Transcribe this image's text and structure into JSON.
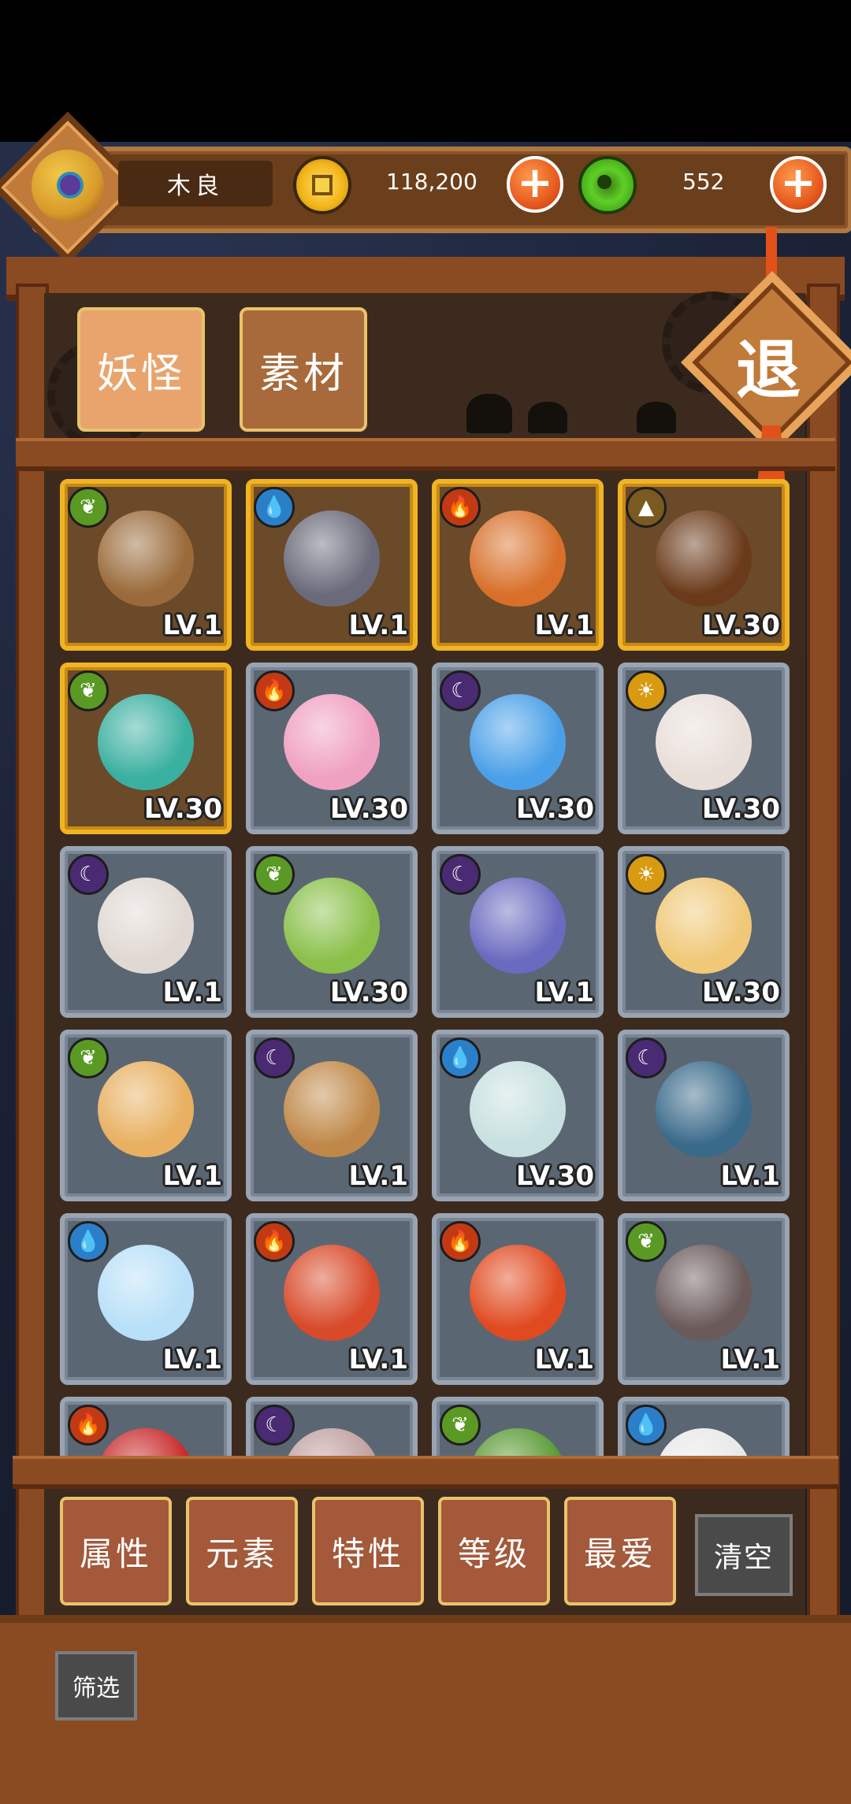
{
  "player": {
    "name": "木良"
  },
  "currency": {
    "coins": "118,200",
    "jade": "552",
    "plus": "+"
  },
  "tabs": [
    {
      "label": "妖怪",
      "active": true
    },
    {
      "label": "素材",
      "active": false
    }
  ],
  "exit_label": "退",
  "elements": {
    "wood": {
      "color": "#5a9a24",
      "glyph": "❦"
    },
    "water": {
      "color": "#2a7fc8",
      "glyph": "💧"
    },
    "fire": {
      "color": "#c23a14",
      "glyph": "🔥"
    },
    "earth": {
      "color": "#7a5a20",
      "glyph": "▲"
    },
    "dark": {
      "color": "#4a2a72",
      "glyph": "☾"
    },
    "light": {
      "color": "#d89a10",
      "glyph": "☀"
    }
  },
  "cards": [
    {
      "element": "wood",
      "level": "LV.1",
      "frame": "gold",
      "art": "#9a6a3a"
    },
    {
      "element": "water",
      "level": "LV.1",
      "frame": "gold",
      "art": "#6a6a7a"
    },
    {
      "element": "fire",
      "level": "LV.1",
      "frame": "gold",
      "art": "#d8702a"
    },
    {
      "element": "earth",
      "level": "LV.30",
      "frame": "gold",
      "art": "#6a3a1a"
    },
    {
      "element": "wood",
      "level": "LV.30",
      "frame": "gold",
      "art": "#3ab0a0"
    },
    {
      "element": "fire",
      "level": "LV.30",
      "frame": "silver",
      "art": "#f0a0c0"
    },
    {
      "element": "dark",
      "level": "LV.30",
      "frame": "silver",
      "art": "#4aa0e8"
    },
    {
      "element": "light",
      "level": "LV.30",
      "frame": "silver",
      "art": "#e8ded8"
    },
    {
      "element": "dark",
      "level": "LV.1",
      "frame": "silver",
      "art": "#e0d8d2"
    },
    {
      "element": "wood",
      "level": "LV.30",
      "frame": "silver",
      "art": "#8ac04a"
    },
    {
      "element": "dark",
      "level": "LV.1",
      "frame": "silver",
      "art": "#6a6ac0"
    },
    {
      "element": "light",
      "level": "LV.30",
      "frame": "silver",
      "art": "#f0c878"
    },
    {
      "element": "wood",
      "level": "LV.1",
      "frame": "silver",
      "art": "#e8b060"
    },
    {
      "element": "dark",
      "level": "LV.1",
      "frame": "silver",
      "art": "#c08848"
    },
    {
      "element": "water",
      "level": "LV.30",
      "frame": "silver",
      "art": "#c8e0e0"
    },
    {
      "element": "dark",
      "level": "LV.1",
      "frame": "silver",
      "art": "#3a6a8a"
    },
    {
      "element": "water",
      "level": "LV.1",
      "frame": "silver",
      "art": "#b8e0f8"
    },
    {
      "element": "fire",
      "level": "LV.1",
      "frame": "silver",
      "art": "#d84a2a"
    },
    {
      "element": "fire",
      "level": "LV.1",
      "frame": "silver",
      "art": "#e04a20"
    },
    {
      "element": "wood",
      "level": "LV.1",
      "frame": "silver",
      "art": "#6a5a5a"
    },
    {
      "element": "fire",
      "level": "",
      "frame": "silver",
      "art": "#c82a2a"
    },
    {
      "element": "dark",
      "level": "",
      "frame": "silver",
      "art": "#c0a0a0"
    },
    {
      "element": "wood",
      "level": "",
      "frame": "silver",
      "art": "#5a9a34"
    },
    {
      "element": "water",
      "level": "",
      "frame": "silver",
      "art": "#e8e8e8"
    }
  ],
  "filters": [
    "属性",
    "元素",
    "特性",
    "等级",
    "最爱"
  ],
  "clear_label": "清空",
  "filter_label": "筛选"
}
